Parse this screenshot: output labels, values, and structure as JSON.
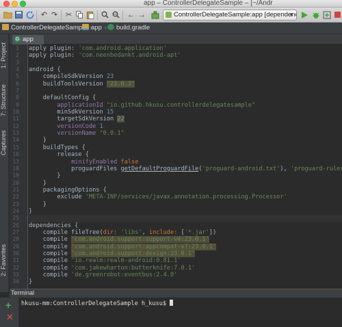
{
  "window": {
    "title": "app – ControllerDelegateSample – [~/Andr"
  },
  "toolbar": {
    "run_config_label": "ControllerDelegateSample:app [dependencies]"
  },
  "breadcrumbs": [
    {
      "label": "ControllerDelegateSample",
      "icon": "folder-icon"
    },
    {
      "label": "app",
      "icon": "module-folder-icon"
    },
    {
      "label": "build.gradle",
      "icon": "gradle-file-icon"
    }
  ],
  "sidebar": {
    "tabs": [
      "1: Project",
      "7: Structure",
      "Captures",
      "2: Favorites"
    ]
  },
  "editor": {
    "tab_label": "app",
    "line_numbers": [
      "1",
      "2",
      "3",
      "4",
      "5",
      "6",
      "7",
      "8",
      "9",
      "10",
      "11",
      "12",
      "13",
      "14",
      "15",
      "16",
      "17",
      "18",
      "19",
      "20",
      "21",
      "22",
      "23",
      "24",
      "25",
      "26",
      "27",
      "28",
      "29",
      "30",
      "31",
      "32",
      "33",
      "34"
    ],
    "lines": [
      [
        {
          "t": "apply plugin: ",
          "c": ""
        },
        {
          "t": "'com.android.application'",
          "c": "str"
        }
      ],
      [
        {
          "t": "apply plugin: ",
          "c": ""
        },
        {
          "t": "'com.neenbedankt.android-apt'",
          "c": "str"
        }
      ],
      [],
      [
        {
          "t": "android {",
          "c": ""
        }
      ],
      [
        {
          "t": "    compileSdkVersion ",
          "c": ""
        },
        {
          "t": "23",
          "c": "num"
        }
      ],
      [
        {
          "t": "    buildToolsVersion ",
          "c": ""
        },
        {
          "t": "\"23.0.3\"",
          "c": "hlstr"
        }
      ],
      [],
      [
        {
          "t": "    defaultConfig {",
          "c": ""
        }
      ],
      [
        {
          "t": "        ",
          "c": ""
        },
        {
          "t": "applicationId ",
          "c": "prop"
        },
        {
          "t": "\"io.github.hkusu.controllerdelegatesample\"",
          "c": "str"
        }
      ],
      [
        {
          "t": "        minSdkVersion ",
          "c": ""
        },
        {
          "t": "15",
          "c": "num"
        }
      ],
      [
        {
          "t": "        targetSdkVersion ",
          "c": ""
        },
        {
          "t": "22",
          "c": "hlnum"
        }
      ],
      [
        {
          "t": "        ",
          "c": ""
        },
        {
          "t": "versionCode ",
          "c": "prop"
        },
        {
          "t": "1",
          "c": "num"
        }
      ],
      [
        {
          "t": "        ",
          "c": ""
        },
        {
          "t": "versionName ",
          "c": "prop"
        },
        {
          "t": "\"0.0.1\"",
          "c": "str"
        }
      ],
      [
        {
          "t": "    }",
          "c": ""
        }
      ],
      [
        {
          "t": "    buildTypes {",
          "c": ""
        }
      ],
      [
        {
          "t": "        release {",
          "c": ""
        }
      ],
      [
        {
          "t": "            ",
          "c": ""
        },
        {
          "t": "minifyEnabled ",
          "c": "prop"
        },
        {
          "t": "false",
          "c": "kw"
        }
      ],
      [
        {
          "t": "            proguardFiles ",
          "c": ""
        },
        {
          "t": "getDefaultProguardFile",
          "c": "method"
        },
        {
          "t": "(",
          "c": ""
        },
        {
          "t": "'proguard-android.txt'",
          "c": "str"
        },
        {
          "t": "), ",
          "c": ""
        },
        {
          "t": "'proguard-rules.pro'",
          "c": "str"
        }
      ],
      [
        {
          "t": "        }",
          "c": ""
        }
      ],
      [
        {
          "t": "    }",
          "c": ""
        }
      ],
      [
        {
          "t": "    packagingOptions {",
          "c": ""
        }
      ],
      [
        {
          "t": "        exclude ",
          "c": ""
        },
        {
          "t": "'META-INF/services/javax.annotation.processing.Processor'",
          "c": "str"
        }
      ],
      [
        {
          "t": "    }",
          "c": ""
        }
      ],
      [
        {
          "t": "}",
          "c": ""
        }
      ],
      [],
      [
        {
          "t": "dependencies {",
          "c": ""
        }
      ],
      [
        {
          "t": "    compile fileTree(",
          "c": ""
        },
        {
          "t": "dir: ",
          "c": "kw"
        },
        {
          "t": "'libs'",
          "c": "str"
        },
        {
          "t": ", ",
          "c": ""
        },
        {
          "t": "include: ",
          "c": "kw"
        },
        {
          "t": "[",
          "c": ""
        },
        {
          "t": "'*.jar'",
          "c": "str"
        },
        {
          "t": "])",
          "c": ""
        }
      ],
      [
        {
          "t": "    compile ",
          "c": ""
        },
        {
          "t": "'com.android.support:support-v4:23.0.1'",
          "c": "hlstr"
        }
      ],
      [
        {
          "t": "    compile ",
          "c": ""
        },
        {
          "t": "'com.android.support:appcompat-v7:23.0.1'",
          "c": "hlstr"
        }
      ],
      [
        {
          "t": "    compile ",
          "c": ""
        },
        {
          "t": "'com.android.support:design:23.0.1'",
          "c": "hlstr"
        }
      ],
      [
        {
          "t": "    compile ",
          "c": ""
        },
        {
          "t": "'io.realm:realm-android:0.81.1'",
          "c": "str"
        }
      ],
      [
        {
          "t": "    compile ",
          "c": ""
        },
        {
          "t": "'com.jakewharton:butterknife:7.0.1'",
          "c": "str"
        }
      ],
      [
        {
          "t": "    compile ",
          "c": ""
        },
        {
          "t": "'de.greenrobot:eventbus:2.4.0'",
          "c": "str"
        }
      ],
      [
        {
          "t": "}",
          "c": ""
        }
      ]
    ],
    "current_line_index": 24
  },
  "terminal": {
    "header_label": "Terminal",
    "prompt": "hkusu-mm:ControllerDelegateSample h_kusu$ "
  },
  "colors": {
    "keyword": "#cc7832",
    "string": "#6a8759",
    "number": "#6897bb",
    "property": "#9876aa",
    "warning_highlight": "#52503a",
    "background": "#2b2b2b"
  }
}
